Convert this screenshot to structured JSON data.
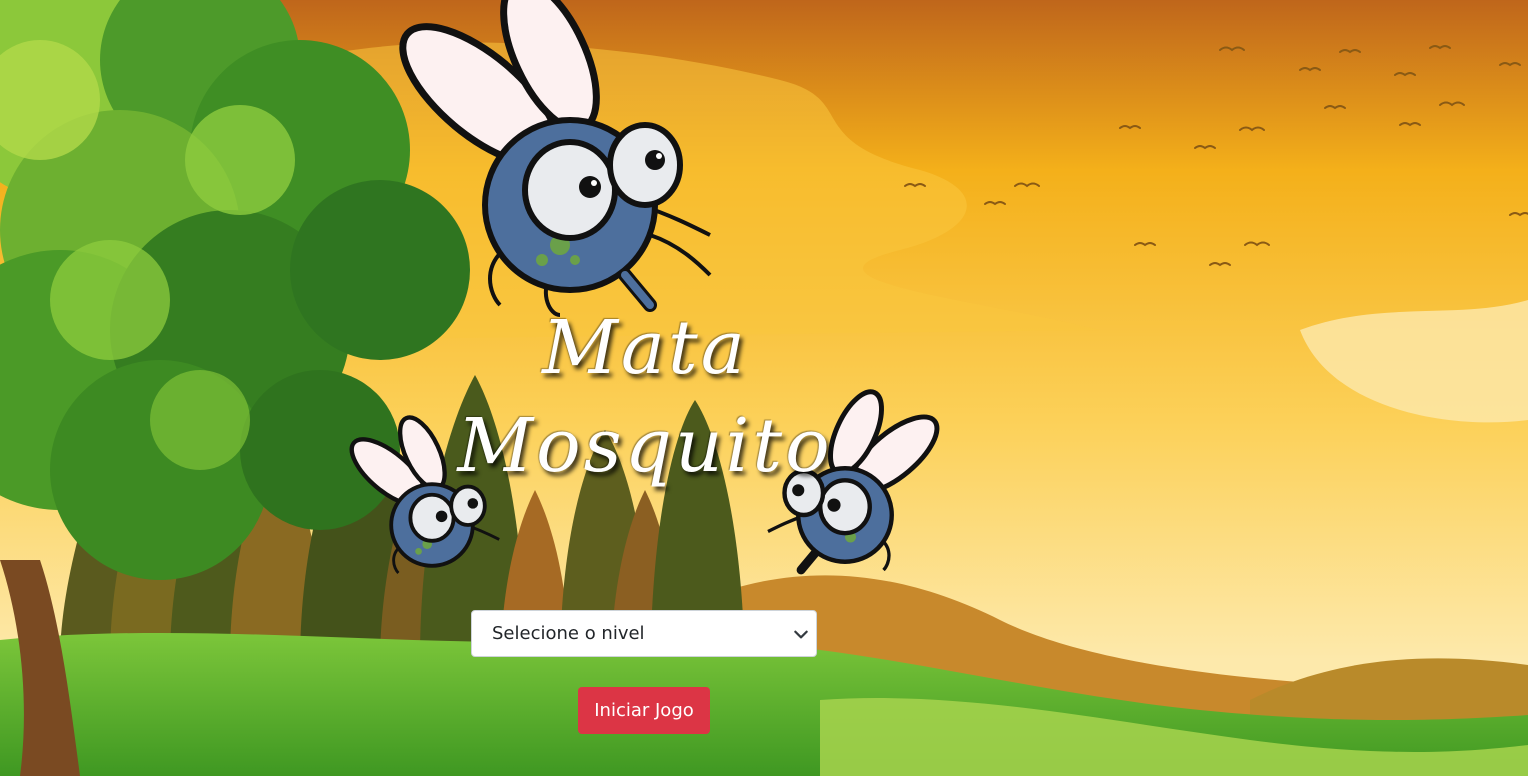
{
  "game": {
    "title_line1": "Mata",
    "title_line2": "Mosquito"
  },
  "level_select": {
    "selected": "Selecione o nivel"
  },
  "start_button": {
    "label": "Iniciar Jogo"
  },
  "colors": {
    "sky_top": "#c1651b",
    "sky_mid": "#f5b51a",
    "sky_bottom": "#fde8a6",
    "grass": "#5fae27",
    "tree_foliage": "#3f8e24",
    "mosquito_body": "#4d6f9d",
    "button_red": "#dc3545"
  },
  "icons": [
    "mosquito-icon",
    "bird-icon",
    "chevron-down-icon"
  ]
}
